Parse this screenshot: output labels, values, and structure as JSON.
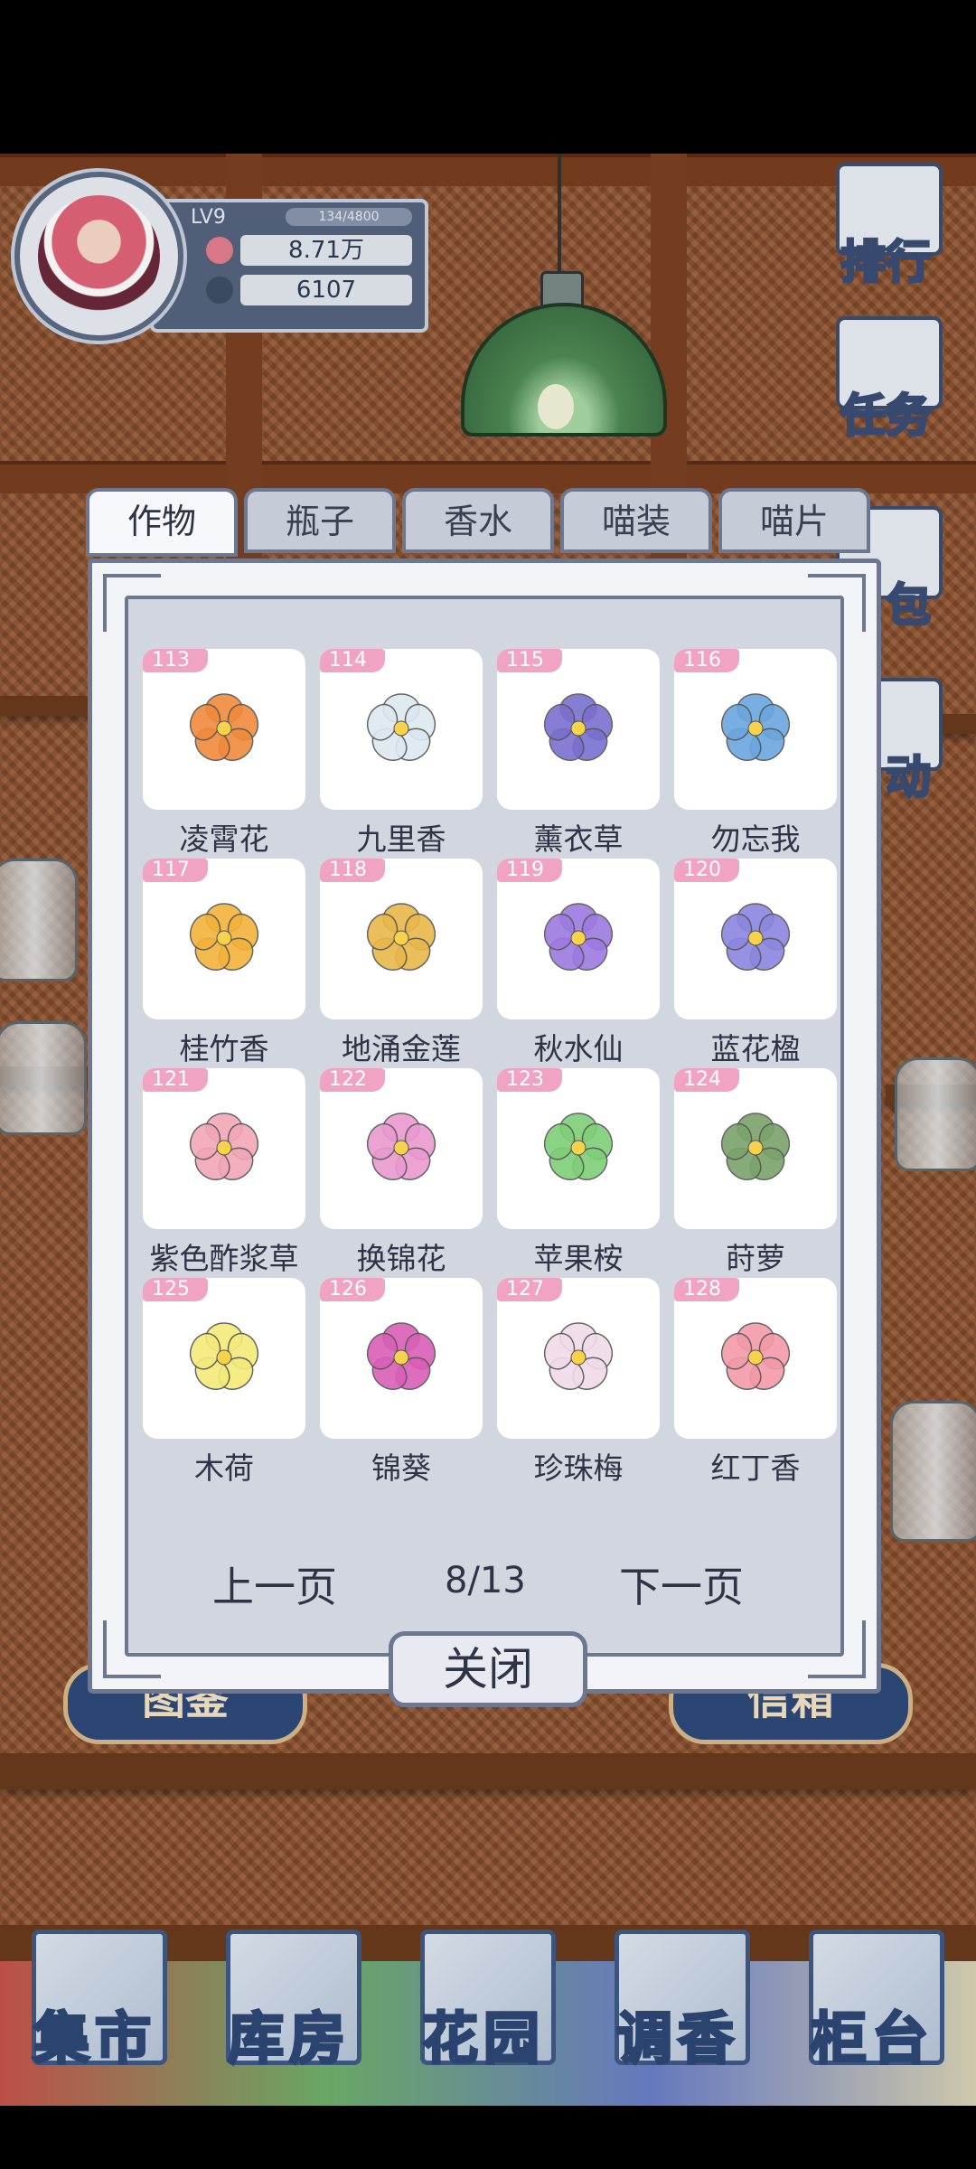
{
  "profile": {
    "level": "LV9",
    "exp": "134/4800",
    "currency1": "8.71万",
    "currency2": "6107"
  },
  "side_buttons": [
    {
      "label": "排行",
      "icon": "ranking-icon"
    },
    {
      "label": "任务",
      "icon": "task-icon"
    },
    {
      "label": "包",
      "icon": "bag-icon"
    },
    {
      "label": "动",
      "icon": "activity-icon"
    }
  ],
  "background_signs": [
    {
      "label": "图鉴"
    },
    {
      "label": "信箱"
    }
  ],
  "tabs": [
    {
      "label": "作物",
      "active": true
    },
    {
      "label": "瓶子",
      "active": false
    },
    {
      "label": "香水",
      "active": false
    },
    {
      "label": "喵装",
      "active": false
    },
    {
      "label": "喵片",
      "active": false
    }
  ],
  "items": [
    {
      "id": "113",
      "name": "凌霄花",
      "color": "#f08a3c",
      "icon": "trumpet-flower-icon"
    },
    {
      "id": "114",
      "name": "九里香",
      "color": "#dce8f0",
      "icon": "murraya-flower-icon"
    },
    {
      "id": "115",
      "name": "薰衣草",
      "color": "#7a6fd0",
      "icon": "lavender-flower-icon"
    },
    {
      "id": "116",
      "name": "勿忘我",
      "color": "#6aa6de",
      "icon": "forget-me-not-icon"
    },
    {
      "id": "117",
      "name": "桂竹香",
      "color": "#f3b33a",
      "icon": "wallflower-icon"
    },
    {
      "id": "118",
      "name": "地涌金莲",
      "color": "#e8b84a",
      "icon": "golden-lotus-icon"
    },
    {
      "id": "119",
      "name": "秋水仙",
      "color": "#9d7ae0",
      "icon": "colchicum-icon"
    },
    {
      "id": "120",
      "name": "蓝花楹",
      "color": "#8c86e0",
      "icon": "jacaranda-icon"
    },
    {
      "id": "121",
      "name": "紫色酢浆草",
      "color": "#f2a7b8",
      "icon": "oxalis-icon"
    },
    {
      "id": "122",
      "name": "换锦花",
      "color": "#e99ad0",
      "icon": "lycoris-icon"
    },
    {
      "id": "123",
      "name": "苹果桉",
      "color": "#7fcf77",
      "icon": "apple-gum-leaf-icon"
    },
    {
      "id": "124",
      "name": "莳萝",
      "color": "#7aa36b",
      "icon": "dill-icon"
    },
    {
      "id": "125",
      "name": "木荷",
      "color": "#f4ea7a",
      "icon": "schima-flower-icon"
    },
    {
      "id": "126",
      "name": "锦葵",
      "color": "#d95fb6",
      "icon": "mallow-flower-icon"
    },
    {
      "id": "127",
      "name": "珍珠梅",
      "color": "#f0dbe8",
      "icon": "pearl-plum-icon"
    },
    {
      "id": "128",
      "name": "红丁香",
      "color": "#f39aa8",
      "icon": "red-lilac-icon"
    }
  ],
  "pager": {
    "prev": "上一页",
    "page": "8/13",
    "next": "下一页"
  },
  "close_label": "关闭",
  "nav": [
    {
      "label": "集市",
      "icon": "market-icon"
    },
    {
      "label": "库房",
      "icon": "warehouse-icon"
    },
    {
      "label": "花园",
      "icon": "garden-rose-icon"
    },
    {
      "label": "调香",
      "icon": "perfume-mixing-icon"
    },
    {
      "label": "柜台",
      "icon": "counter-icon"
    }
  ]
}
